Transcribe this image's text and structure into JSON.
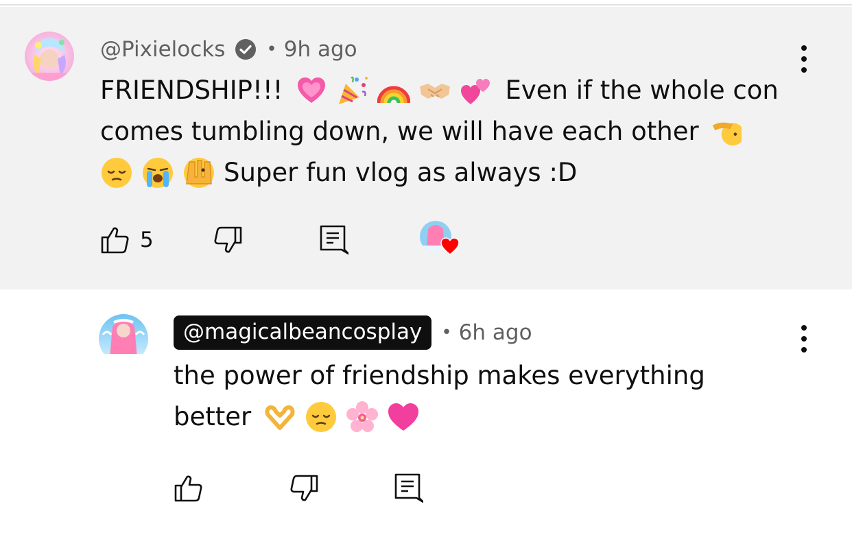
{
  "comments": [
    {
      "handle": "@Pixielocks",
      "verified": true,
      "time": "9h ago",
      "lines": [
        [
          "FRIENDSHIP!!!",
          "heart-sparkle",
          "party-popper",
          "rainbow",
          "handshake",
          "two-hearts",
          "Even if the whole con"
        ],
        [
          "comes tumbling down, we will have each other",
          "saluting-face"
        ],
        [
          "pensive-face",
          "crying-face",
          "peeking-face",
          "Super fun vlog as always :D"
        ]
      ],
      "line_texts": {
        "l1a": "FRIENDSHIP!!!",
        "l1b": "Even if the whole con",
        "l2a": "comes tumbling down, we will have each other",
        "l3a": "Super fun vlog as always :D"
      },
      "likes": "5",
      "creator_hearted": true
    },
    {
      "handle": "@magicalbeancosplay",
      "highlighted_handle": true,
      "time": "6h ago",
      "line_texts": {
        "l1a": "the power of friendship makes everything",
        "l2a": "better"
      },
      "likes": ""
    }
  ],
  "separator": "•",
  "colors": {
    "highlight_bg": "#f2f2f2",
    "text": "#0f0f0f",
    "meta": "#606060",
    "heart": "#ff0000"
  },
  "icons": [
    "more-vert-icon",
    "like-icon",
    "dislike-icon",
    "reply-icon",
    "verified-icon",
    "heart-icon"
  ]
}
